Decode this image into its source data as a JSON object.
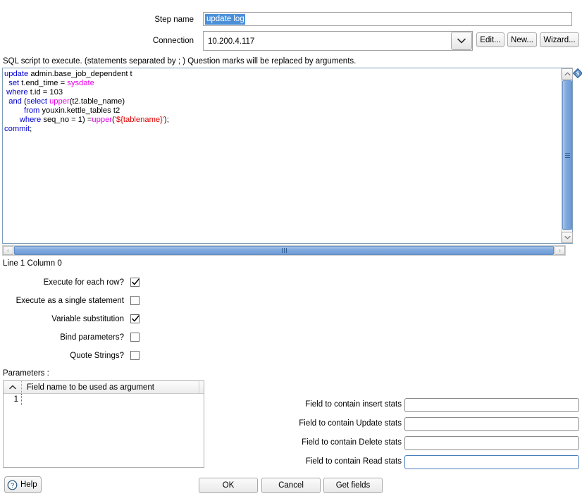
{
  "dialog": {
    "step_name_label": "Step name",
    "step_name_value": "update log",
    "connection_label": "Connection",
    "connection_value": "10.200.4.117",
    "connection_buttons": {
      "edit": "Edit...",
      "new": "New...",
      "wizard": "Wizard..."
    },
    "sql_hint": "SQL script to execute. (statements separated by ; ) Question marks will be replaced by arguments.",
    "line_column_status": "Line 1 Column 0"
  },
  "sql_script": {
    "text": "update admin.base_job_dependent t\n  set t.end_time = sysdate\n where t.id = 103\n  and (select upper(t2.table_name)\n         from youxin.kettle_tables t2\n       where seq_no = 1) =upper('${tablename}');\ncommit;",
    "lines": [
      {
        "tokens": [
          {
            "t": "update",
            "c": "kw"
          },
          {
            "t": " admin.base_job_dependent t",
            "c": "plain"
          }
        ]
      },
      {
        "tokens": [
          {
            "t": "  ",
            "c": "plain"
          },
          {
            "t": "set",
            "c": "kw"
          },
          {
            "t": " t.end_time = ",
            "c": "plain"
          },
          {
            "t": "sysdate",
            "c": "fn"
          }
        ]
      },
      {
        "tokens": [
          {
            "t": " ",
            "c": "plain"
          },
          {
            "t": "where",
            "c": "kw"
          },
          {
            "t": " t.id = 103",
            "c": "plain"
          }
        ]
      },
      {
        "tokens": [
          {
            "t": "  ",
            "c": "plain"
          },
          {
            "t": "and",
            "c": "kw"
          },
          {
            "t": " (",
            "c": "plain"
          },
          {
            "t": "select",
            "c": "kw"
          },
          {
            "t": " ",
            "c": "plain"
          },
          {
            "t": "upper",
            "c": "fn"
          },
          {
            "t": "(t2.table_name)",
            "c": "plain"
          }
        ]
      },
      {
        "tokens": [
          {
            "t": "         ",
            "c": "plain"
          },
          {
            "t": "from",
            "c": "kw"
          },
          {
            "t": " youxin.kettle_tables t2",
            "c": "plain"
          }
        ]
      },
      {
        "tokens": [
          {
            "t": "       ",
            "c": "plain"
          },
          {
            "t": "where",
            "c": "kw"
          },
          {
            "t": " seq_no = 1) =",
            "c": "plain"
          },
          {
            "t": "upper",
            "c": "fn"
          },
          {
            "t": "(",
            "c": "plain"
          },
          {
            "t": "'${tablename}'",
            "c": "str"
          },
          {
            "t": ");",
            "c": "plain"
          }
        ]
      },
      {
        "tokens": [
          {
            "t": "commit",
            "c": "kw"
          },
          {
            "t": ";",
            "c": "plain"
          }
        ]
      }
    ]
  },
  "checkboxes": [
    {
      "label": "Execute for each row?",
      "checked": true
    },
    {
      "label": "Execute as a single statement",
      "checked": false
    },
    {
      "label": "Variable substitution",
      "checked": true
    },
    {
      "label": "Bind parameters?",
      "checked": false
    },
    {
      "label": "Quote Strings?",
      "checked": false
    }
  ],
  "parameters": {
    "section_label": "Parameters :",
    "columns": [
      "",
      "Field name to be used as argument"
    ],
    "rows": [
      {
        "index": "1",
        "field_name": ""
      }
    ]
  },
  "stats_fields": [
    {
      "label": "Field to contain insert stats",
      "value": "",
      "focused": false
    },
    {
      "label": "Field to contain Update stats",
      "value": "",
      "focused": false
    },
    {
      "label": "Field to contain Delete stats",
      "value": "",
      "focused": false
    },
    {
      "label": "Field to contain Read stats",
      "value": "",
      "focused": true
    }
  ],
  "footer": {
    "help": "Help",
    "ok": "OK",
    "cancel": "Cancel",
    "get_fields": "Get fields"
  },
  "colors": {
    "selection_blue": "#4a90d9",
    "scrollbar_blue": "#7fa8dd",
    "keyword": "#0000d0",
    "function": "#e800e8",
    "string": "#e00000",
    "focus_border": "#4a7ebb"
  }
}
